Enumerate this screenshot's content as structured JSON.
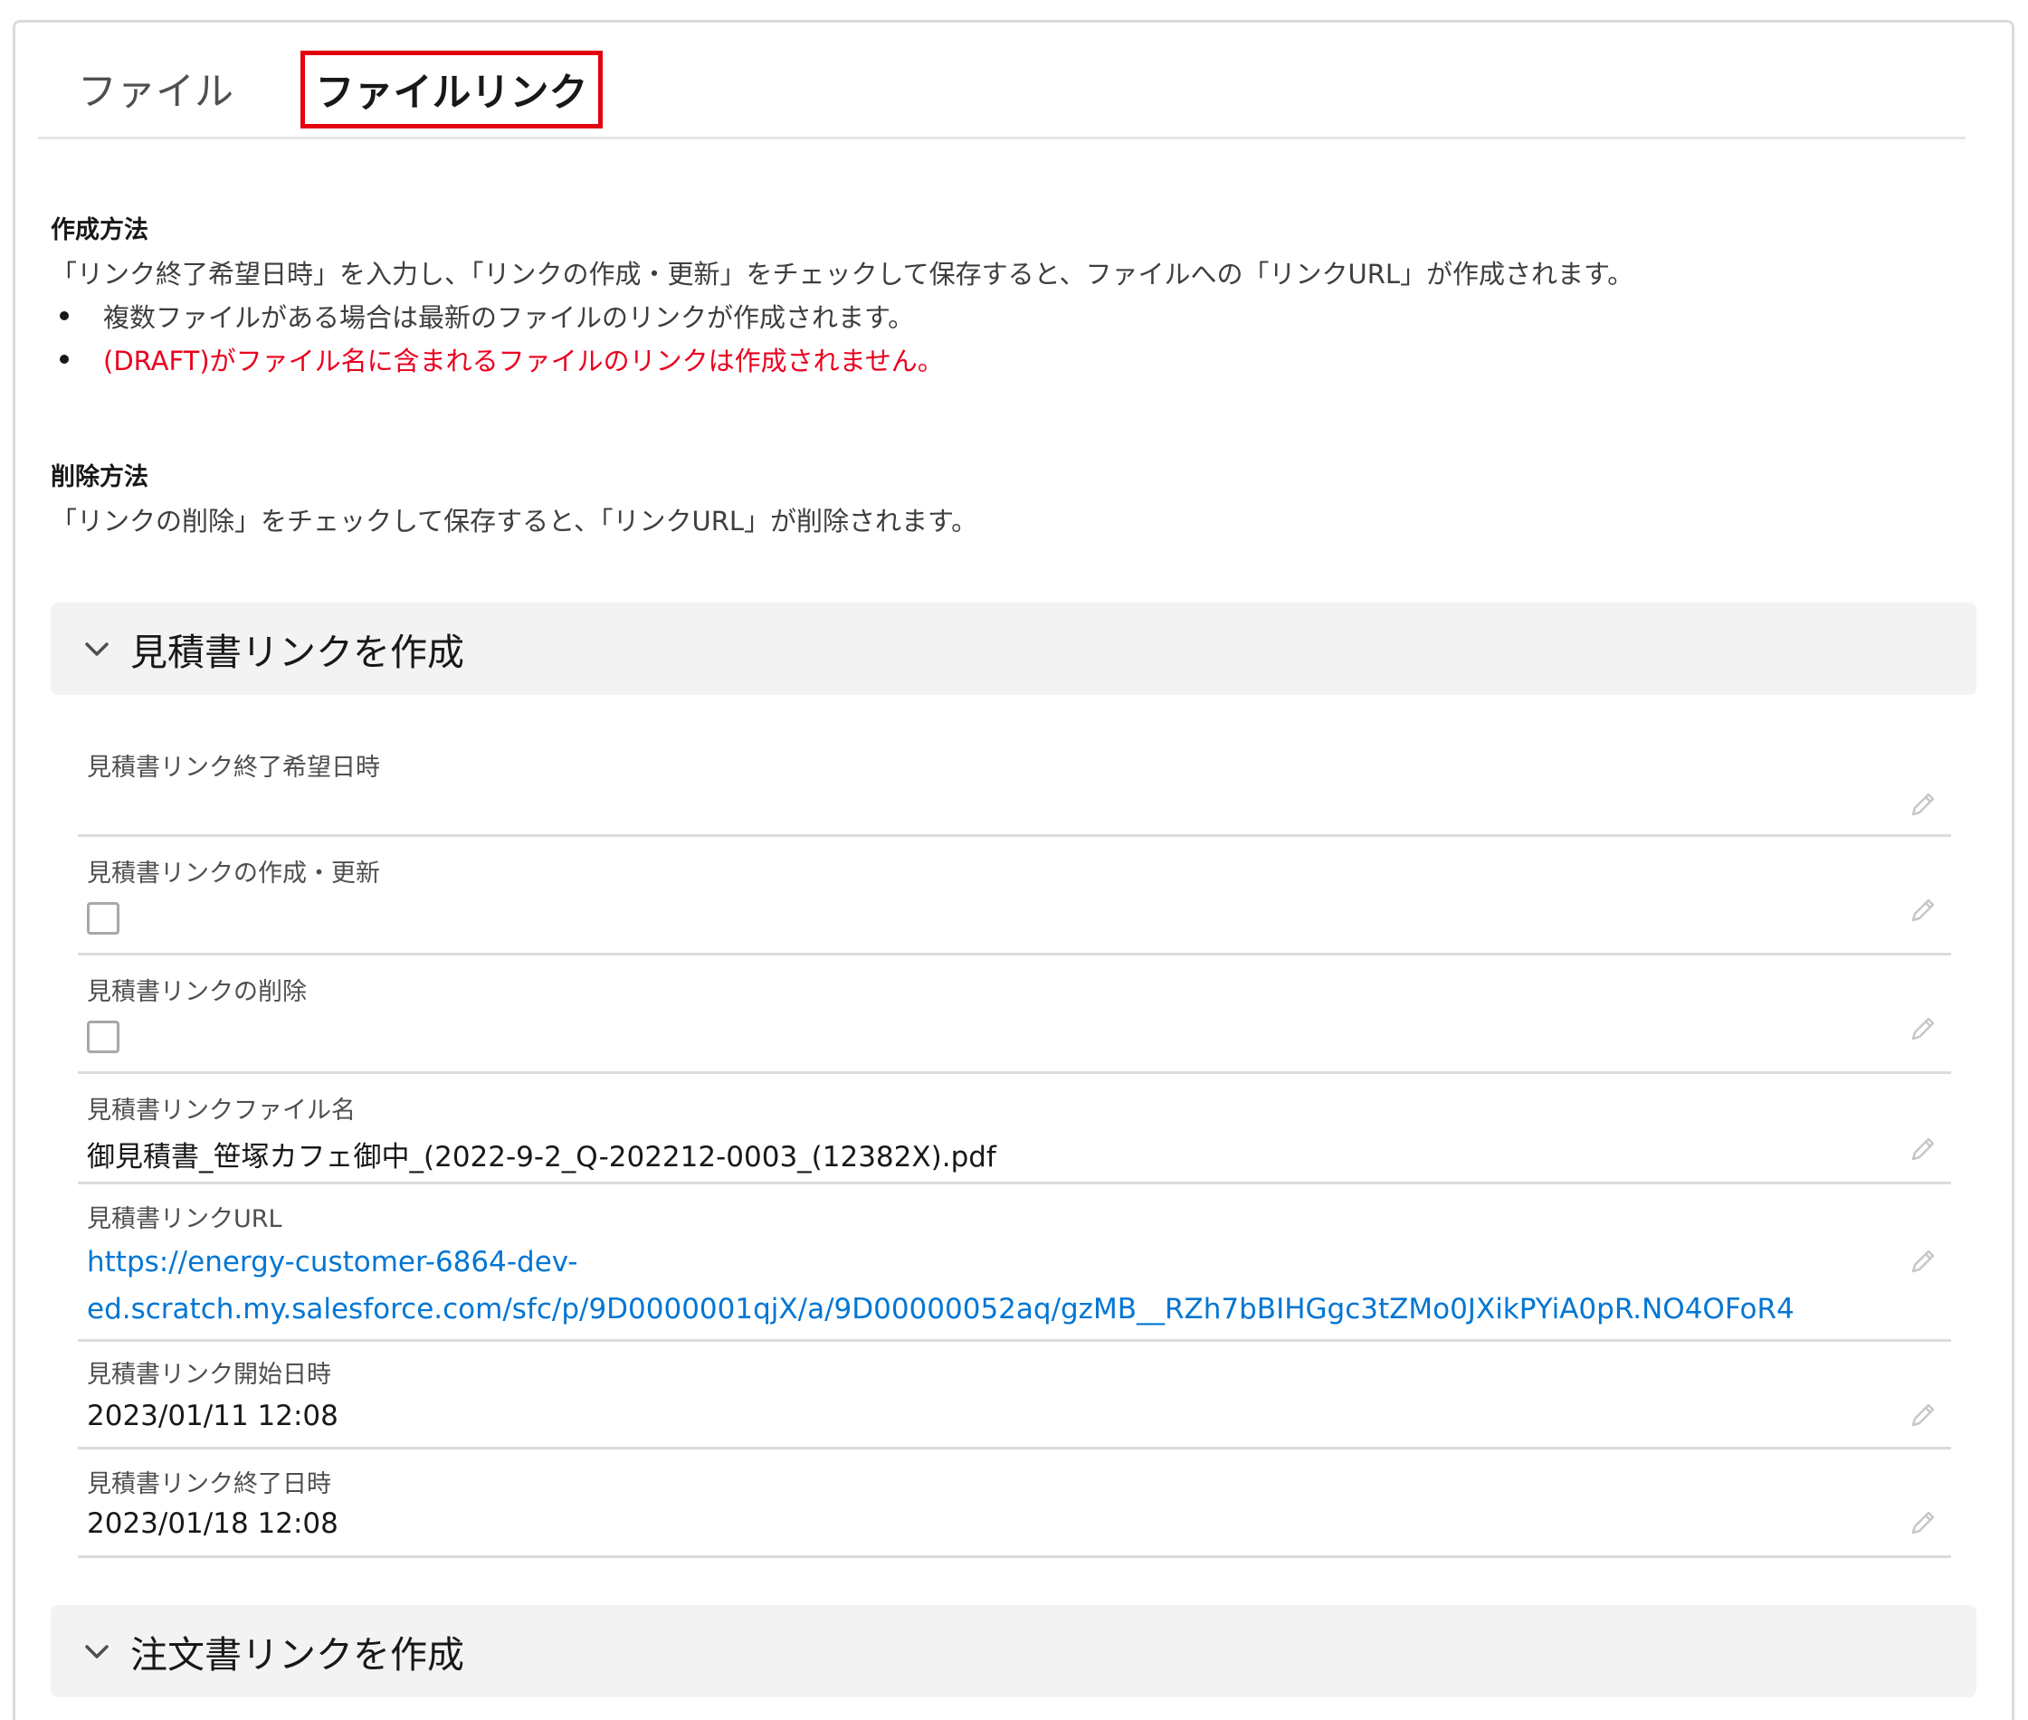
{
  "tabs": {
    "file": "ファイル",
    "file_link": "ファイルリンク"
  },
  "info": {
    "create_title": "作成方法",
    "create_text": "「リンク終了希望日時」を入力し、「リンクの作成・更新」をチェックして保存すると、ファイルへの「リンクURL」が作成されます。",
    "bullet1": "複数ファイルがある場合は最新のファイルのリンクが作成されます。",
    "bullet2": "(DRAFT)がファイル名に含まれるファイルのリンクは作成されません。",
    "delete_title": "削除方法",
    "delete_text": "「リンクの削除」をチェックして保存すると、「リンクURL」が削除されます。"
  },
  "quote_section": {
    "title": "見積書リンクを作成",
    "fields": {
      "end_request": {
        "label": "見積書リンク終了希望日時",
        "value": ""
      },
      "create_update": {
        "label": "見積書リンクの作成・更新",
        "checked": false
      },
      "delete": {
        "label": "見積書リンクの削除",
        "checked": false
      },
      "file_name": {
        "label": "見積書リンクファイル名",
        "value": "御見積書_笹塚カフェ御中_(2022-9-2_Q-202212-0003_(12382X).pdf"
      },
      "url": {
        "label": "見積書リンクURL",
        "line1": "https://energy-customer-6864-dev-",
        "line2": "ed.scratch.my.salesforce.com/sfc/p/9D0000001qjX/a/9D00000052aq/gzMB__RZh7bBIHGgc3tZMo0JXikPYiA0pR.NO4OFoR4"
      },
      "start_date": {
        "label": "見積書リンク開始日時",
        "value": "2023/01/11 12:08"
      },
      "end_date": {
        "label": "見積書リンク終了日時",
        "value": "2023/01/18 12:08"
      }
    }
  },
  "order_section": {
    "title": "注文書リンクを作成"
  },
  "colors": {
    "accent_red": "#e3000f",
    "warning_text": "#ea001e",
    "link_blue": "#0176d3"
  },
  "icons": {
    "chevron": "chevron-down-icon",
    "edit": "pencil-icon"
  }
}
